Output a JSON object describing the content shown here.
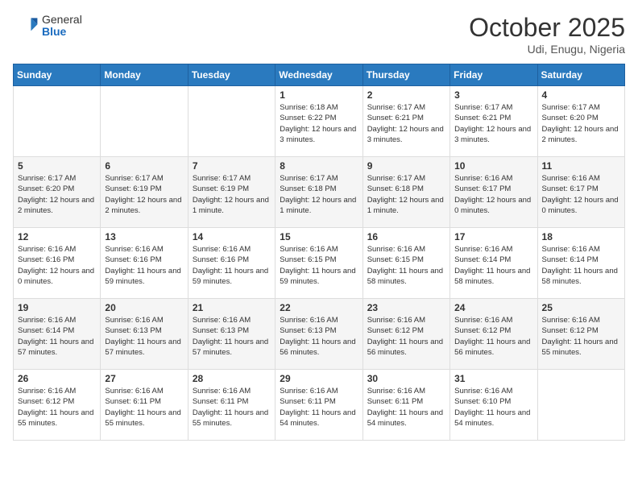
{
  "header": {
    "logo_general": "General",
    "logo_blue": "Blue",
    "month": "October 2025",
    "location": "Udi, Enugu, Nigeria"
  },
  "weekdays": [
    "Sunday",
    "Monday",
    "Tuesday",
    "Wednesday",
    "Thursday",
    "Friday",
    "Saturday"
  ],
  "weeks": [
    [
      {
        "day": "",
        "sunrise": "",
        "sunset": "",
        "daylight": ""
      },
      {
        "day": "",
        "sunrise": "",
        "sunset": "",
        "daylight": ""
      },
      {
        "day": "",
        "sunrise": "",
        "sunset": "",
        "daylight": ""
      },
      {
        "day": "1",
        "sunrise": "6:18 AM",
        "sunset": "6:22 PM",
        "daylight": "12 hours and 3 minutes."
      },
      {
        "day": "2",
        "sunrise": "6:17 AM",
        "sunset": "6:21 PM",
        "daylight": "12 hours and 3 minutes."
      },
      {
        "day": "3",
        "sunrise": "6:17 AM",
        "sunset": "6:21 PM",
        "daylight": "12 hours and 3 minutes."
      },
      {
        "day": "4",
        "sunrise": "6:17 AM",
        "sunset": "6:20 PM",
        "daylight": "12 hours and 2 minutes."
      }
    ],
    [
      {
        "day": "5",
        "sunrise": "6:17 AM",
        "sunset": "6:20 PM",
        "daylight": "12 hours and 2 minutes."
      },
      {
        "day": "6",
        "sunrise": "6:17 AM",
        "sunset": "6:19 PM",
        "daylight": "12 hours and 2 minutes."
      },
      {
        "day": "7",
        "sunrise": "6:17 AM",
        "sunset": "6:19 PM",
        "daylight": "12 hours and 1 minute."
      },
      {
        "day": "8",
        "sunrise": "6:17 AM",
        "sunset": "6:18 PM",
        "daylight": "12 hours and 1 minute."
      },
      {
        "day": "9",
        "sunrise": "6:17 AM",
        "sunset": "6:18 PM",
        "daylight": "12 hours and 1 minute."
      },
      {
        "day": "10",
        "sunrise": "6:16 AM",
        "sunset": "6:17 PM",
        "daylight": "12 hours and 0 minutes."
      },
      {
        "day": "11",
        "sunrise": "6:16 AM",
        "sunset": "6:17 PM",
        "daylight": "12 hours and 0 minutes."
      }
    ],
    [
      {
        "day": "12",
        "sunrise": "6:16 AM",
        "sunset": "6:16 PM",
        "daylight": "12 hours and 0 minutes."
      },
      {
        "day": "13",
        "sunrise": "6:16 AM",
        "sunset": "6:16 PM",
        "daylight": "11 hours and 59 minutes."
      },
      {
        "day": "14",
        "sunrise": "6:16 AM",
        "sunset": "6:16 PM",
        "daylight": "11 hours and 59 minutes."
      },
      {
        "day": "15",
        "sunrise": "6:16 AM",
        "sunset": "6:15 PM",
        "daylight": "11 hours and 59 minutes."
      },
      {
        "day": "16",
        "sunrise": "6:16 AM",
        "sunset": "6:15 PM",
        "daylight": "11 hours and 58 minutes."
      },
      {
        "day": "17",
        "sunrise": "6:16 AM",
        "sunset": "6:14 PM",
        "daylight": "11 hours and 58 minutes."
      },
      {
        "day": "18",
        "sunrise": "6:16 AM",
        "sunset": "6:14 PM",
        "daylight": "11 hours and 58 minutes."
      }
    ],
    [
      {
        "day": "19",
        "sunrise": "6:16 AM",
        "sunset": "6:14 PM",
        "daylight": "11 hours and 57 minutes."
      },
      {
        "day": "20",
        "sunrise": "6:16 AM",
        "sunset": "6:13 PM",
        "daylight": "11 hours and 57 minutes."
      },
      {
        "day": "21",
        "sunrise": "6:16 AM",
        "sunset": "6:13 PM",
        "daylight": "11 hours and 57 minutes."
      },
      {
        "day": "22",
        "sunrise": "6:16 AM",
        "sunset": "6:13 PM",
        "daylight": "11 hours and 56 minutes."
      },
      {
        "day": "23",
        "sunrise": "6:16 AM",
        "sunset": "6:12 PM",
        "daylight": "11 hours and 56 minutes."
      },
      {
        "day": "24",
        "sunrise": "6:16 AM",
        "sunset": "6:12 PM",
        "daylight": "11 hours and 56 minutes."
      },
      {
        "day": "25",
        "sunrise": "6:16 AM",
        "sunset": "6:12 PM",
        "daylight": "11 hours and 55 minutes."
      }
    ],
    [
      {
        "day": "26",
        "sunrise": "6:16 AM",
        "sunset": "6:12 PM",
        "daylight": "11 hours and 55 minutes."
      },
      {
        "day": "27",
        "sunrise": "6:16 AM",
        "sunset": "6:11 PM",
        "daylight": "11 hours and 55 minutes."
      },
      {
        "day": "28",
        "sunrise": "6:16 AM",
        "sunset": "6:11 PM",
        "daylight": "11 hours and 55 minutes."
      },
      {
        "day": "29",
        "sunrise": "6:16 AM",
        "sunset": "6:11 PM",
        "daylight": "11 hours and 54 minutes."
      },
      {
        "day": "30",
        "sunrise": "6:16 AM",
        "sunset": "6:11 PM",
        "daylight": "11 hours and 54 minutes."
      },
      {
        "day": "31",
        "sunrise": "6:16 AM",
        "sunset": "6:10 PM",
        "daylight": "11 hours and 54 minutes."
      },
      {
        "day": "",
        "sunrise": "",
        "sunset": "",
        "daylight": ""
      }
    ]
  ]
}
